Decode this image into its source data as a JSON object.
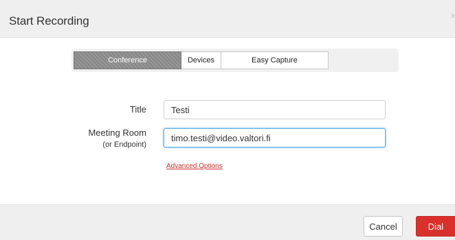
{
  "dialog": {
    "title": "Start Recording",
    "close_label": "x"
  },
  "tabs": [
    {
      "label": "Conference",
      "active": true
    },
    {
      "label": "Devices",
      "active": false
    },
    {
      "label": "Easy Capture",
      "active": false
    }
  ],
  "form": {
    "title_label": "Title",
    "title_value": "Testi",
    "room_label": "Meeting Room",
    "room_sublabel": "(or Endpoint)",
    "room_value": "timo.testi@video.valtori.fi",
    "advanced_link": "Advanced Options"
  },
  "footer": {
    "cancel_label": "Cancel",
    "dial_label": "Dial"
  },
  "colors": {
    "accent_red": "#d9302c",
    "link_red": "#c9302c",
    "active_tab": "#8f8f8f",
    "focus_blue": "#66afe9"
  }
}
